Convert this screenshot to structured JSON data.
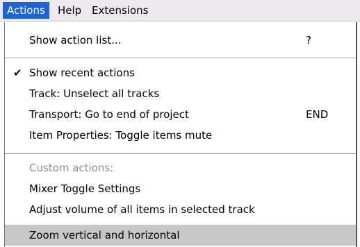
{
  "menubar": {
    "items": [
      {
        "label": "Actions",
        "active": true
      },
      {
        "label": "Help",
        "active": false
      },
      {
        "label": "Extensions",
        "active": false
      }
    ]
  },
  "menu": {
    "show_action_list": {
      "label": "Show action list...",
      "shortcut": "?"
    },
    "show_recent_actions": {
      "label": "Show recent actions",
      "checked": true,
      "check_glyph": "✔"
    },
    "recent": [
      {
        "label": "Track: Unselect all tracks",
        "shortcut": ""
      },
      {
        "label": "Transport: Go to end of project",
        "shortcut": "END"
      },
      {
        "label": "Item Properties: Toggle items mute",
        "shortcut": ""
      }
    ],
    "custom_actions_header": "Custom actions:",
    "custom": [
      {
        "label": "Mixer Toggle Settings"
      },
      {
        "label": "Adjust volume of all items in selected track"
      },
      {
        "label": "Zoom vertical and horizontal",
        "highlighted": true
      }
    ]
  },
  "colors": {
    "menubar_bg": "#ebe9ed",
    "menubar_active": "#1f63d2",
    "highlight_bg": "#c7c7c7",
    "disabled_text": "#8f8f8f"
  }
}
